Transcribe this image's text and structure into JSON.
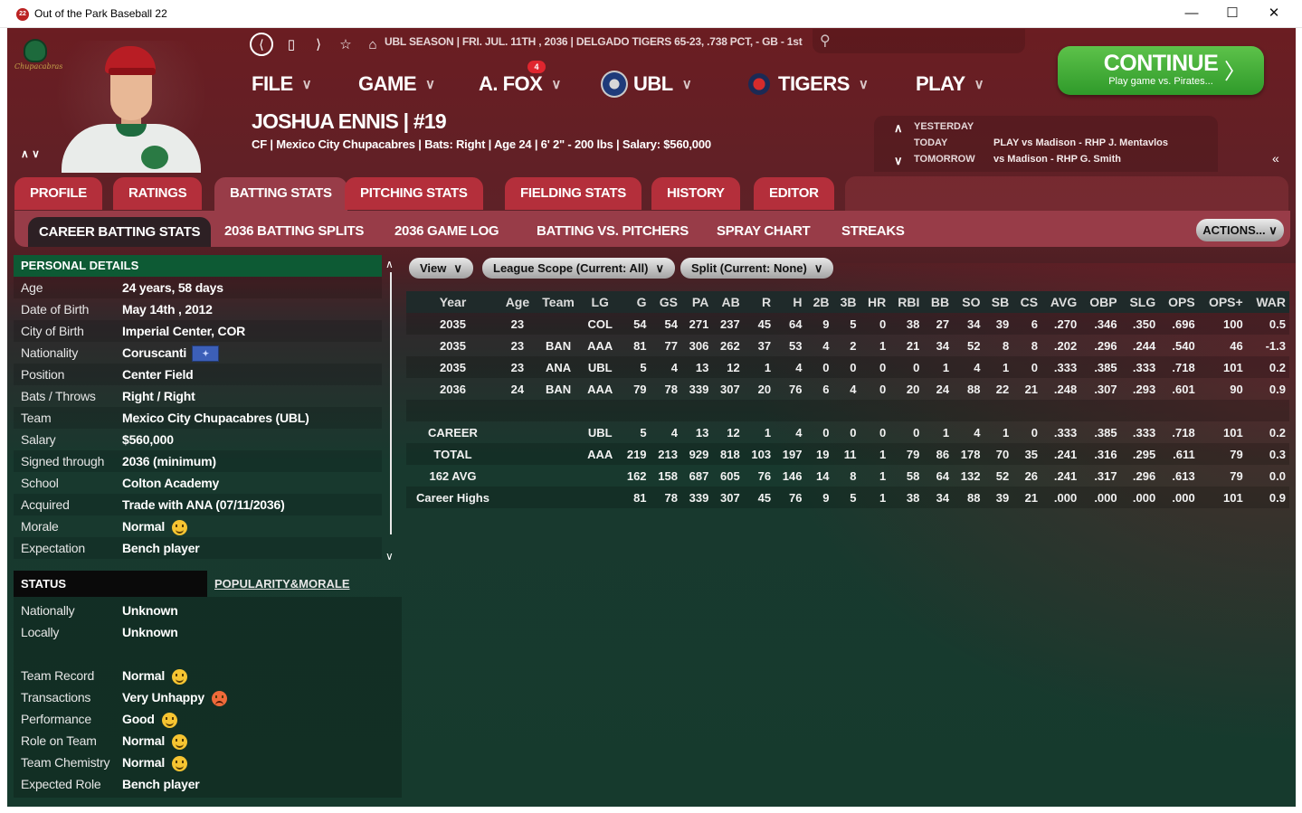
{
  "window": {
    "title": "Out of the Park Baseball 22",
    "app_icon": "22",
    "minimize": "—",
    "maximize": "☐",
    "close": "✕"
  },
  "team_logo_text": "Chupacabras",
  "status_line": "UBL SEASON  |  FRI. JUL. 11TH , 2036  |  DELGADO TIGERS   65-23, .738 PCT, - GB - 1st",
  "menu": {
    "file": "FILE",
    "game": "GAME",
    "manager": "A. FOX",
    "manager_badge": "4",
    "league": "UBL",
    "team": "TIGERS",
    "play": "PLAY",
    "chevron": "∨"
  },
  "continue_button": {
    "label": "CONTINUE",
    "sublabel": "Play game vs. Pirates..."
  },
  "player": {
    "name": "JOSHUA ENNIS  |  #19",
    "info": "CF | Mexico City Chupacabres  |  Bats: Right  |  Age 24  |  6' 2\" - 200 lbs  |  Salary: $560,000"
  },
  "schedule": {
    "yesterday_label": "YESTERDAY",
    "today_label": "TODAY",
    "tomorrow_label": "TOMORROW",
    "today_value": "PLAY vs Madison - RHP J. Mentavlos",
    "tomorrow_value": "vs Madison - RHP G. Smith"
  },
  "tabs": [
    "PROFILE",
    "RATINGS",
    "BATTING STATS",
    "PITCHING STATS",
    "FIELDING STATS",
    "HISTORY",
    "EDITOR"
  ],
  "subtabs": [
    "CAREER BATTING STATS",
    "2036 BATTING SPLITS",
    "2036 GAME LOG",
    "BATTING VS. PITCHERS",
    "SPRAY CHART",
    "STREAKS"
  ],
  "actions_button": "ACTIONS...  ∨",
  "personal_details": {
    "header": "PERSONAL DETAILS",
    "rows": [
      {
        "k": "Age",
        "v": "24 years, 58 days"
      },
      {
        "k": "Date of Birth",
        "v": "May 14th , 2012"
      },
      {
        "k": "City of Birth",
        "v": "Imperial Center, COR"
      },
      {
        "k": "Nationality",
        "v": "Coruscanti"
      },
      {
        "k": "Position",
        "v": "Center Field"
      },
      {
        "k": "Bats / Throws",
        "v": "Right / Right"
      },
      {
        "k": "Team",
        "v": "Mexico City Chupacabres (UBL)"
      },
      {
        "k": "Salary",
        "v": "$560,000"
      },
      {
        "k": "Signed through",
        "v": "2036 (minimum)"
      },
      {
        "k": "School",
        "v": "Colton Academy"
      },
      {
        "k": "Acquired",
        "v": "Trade with ANA (07/11/2036)"
      },
      {
        "k": "Morale",
        "v": "Normal"
      },
      {
        "k": "Expectation",
        "v": "Bench player"
      }
    ]
  },
  "status": {
    "header": "STATUS",
    "link": "POPULARITY&MORALE",
    "rows_top": [
      {
        "k": "Nationally",
        "v": "Unknown"
      },
      {
        "k": "Locally",
        "v": "Unknown"
      }
    ],
    "rows_bottom": [
      {
        "k": "Team Record",
        "v": "Normal"
      },
      {
        "k": "Transactions",
        "v": "Very Unhappy"
      },
      {
        "k": "Performance",
        "v": "Good"
      },
      {
        "k": "Role on Team",
        "v": "Normal"
      },
      {
        "k": "Team Chemistry",
        "v": "Normal"
      },
      {
        "k": "Expected Role",
        "v": "Bench player"
      }
    ]
  },
  "filters": {
    "view": "View",
    "league_scope": "League Scope (Current: All)",
    "split": "Split (Current: None)",
    "chevron": "∨"
  },
  "stats": {
    "columns": [
      "Year",
      "Age",
      "Team",
      "LG",
      "G",
      "GS",
      "PA",
      "AB",
      "R",
      "H",
      "2B",
      "3B",
      "HR",
      "RBI",
      "BB",
      "SO",
      "SB",
      "CS",
      "AVG",
      "OBP",
      "SLG",
      "OPS",
      "OPS+",
      "WAR"
    ],
    "rows": [
      [
        "2035",
        "23",
        "",
        "COL",
        "54",
        "54",
        "271",
        "237",
        "45",
        "64",
        "9",
        "5",
        "0",
        "38",
        "27",
        "34",
        "39",
        "6",
        ".270",
        ".346",
        ".350",
        ".696",
        "100",
        "0.5"
      ],
      [
        "2035",
        "23",
        "BAN",
        "AAA",
        "81",
        "77",
        "306",
        "262",
        "37",
        "53",
        "4",
        "2",
        "1",
        "21",
        "34",
        "52",
        "8",
        "8",
        ".202",
        ".296",
        ".244",
        ".540",
        "46",
        "-1.3"
      ],
      [
        "2035",
        "23",
        "ANA",
        "UBL",
        "5",
        "4",
        "13",
        "12",
        "1",
        "4",
        "0",
        "0",
        "0",
        "0",
        "1",
        "4",
        "1",
        "0",
        ".333",
        ".385",
        ".333",
        ".718",
        "101",
        "0.2"
      ],
      [
        "2036",
        "24",
        "BAN",
        "AAA",
        "79",
        "78",
        "339",
        "307",
        "20",
        "76",
        "6",
        "4",
        "0",
        "20",
        "24",
        "88",
        "22",
        "21",
        ".248",
        ".307",
        ".293",
        ".601",
        "90",
        "0.9"
      ],
      [
        "",
        "",
        "",
        "",
        "",
        "",
        "",
        "",
        "",
        "",
        "",
        "",
        "",
        "",
        "",
        "",
        "",
        "",
        "",
        "",
        "",
        "",
        "",
        ""
      ],
      [
        "CAREER",
        "",
        "",
        "UBL",
        "5",
        "4",
        "13",
        "12",
        "1",
        "4",
        "0",
        "0",
        "0",
        "0",
        "1",
        "4",
        "1",
        "0",
        ".333",
        ".385",
        ".333",
        ".718",
        "101",
        "0.2"
      ],
      [
        "TOTAL",
        "",
        "",
        "AAA",
        "219",
        "213",
        "929",
        "818",
        "103",
        "197",
        "19",
        "11",
        "1",
        "79",
        "86",
        "178",
        "70",
        "35",
        ".241",
        ".316",
        ".295",
        ".611",
        "79",
        "0.3"
      ],
      [
        "162 AVG",
        "",
        "",
        "",
        "162",
        "158",
        "687",
        "605",
        "76",
        "146",
        "14",
        "8",
        "1",
        "58",
        "64",
        "132",
        "52",
        "26",
        ".241",
        ".317",
        ".296",
        ".613",
        "79",
        "0.0"
      ],
      [
        "Career Highs",
        "",
        "",
        "",
        "81",
        "78",
        "339",
        "307",
        "45",
        "76",
        "9",
        "5",
        "1",
        "38",
        "34",
        "88",
        "39",
        "21",
        ".000",
        ".000",
        ".000",
        ".000",
        "101",
        "0.9"
      ]
    ]
  }
}
